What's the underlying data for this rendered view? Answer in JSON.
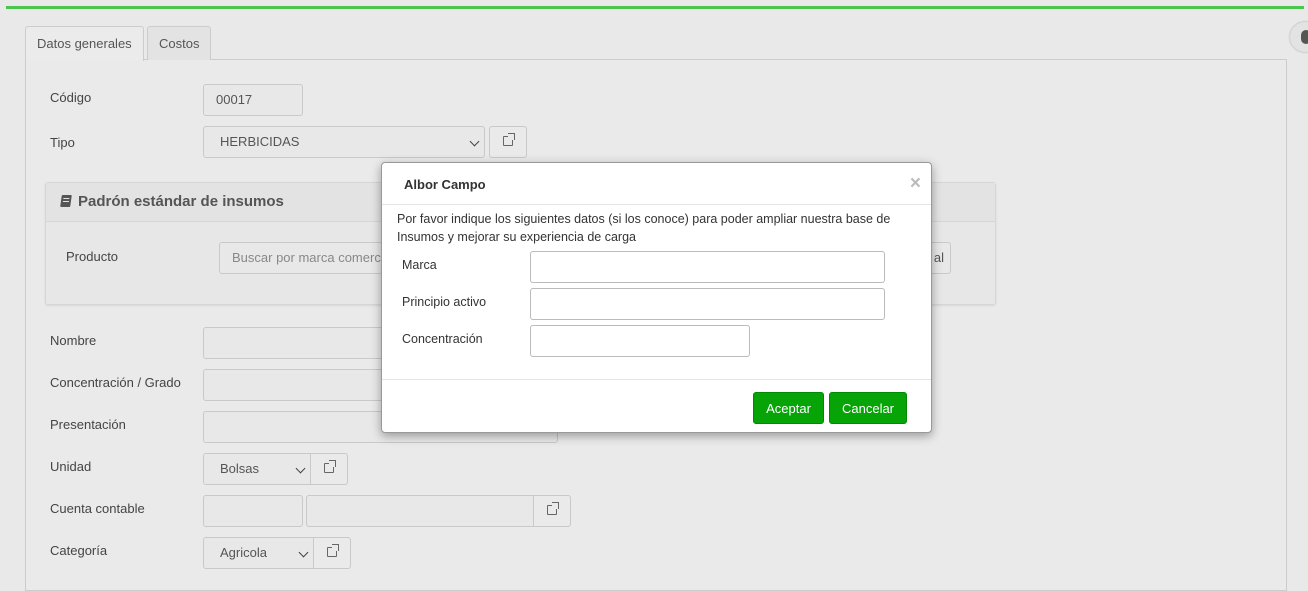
{
  "tabs": [
    {
      "label": "Datos generales",
      "active": true
    },
    {
      "label": "Costos",
      "active": false
    }
  ],
  "form": {
    "codigo_label": "Código",
    "codigo_value": "00017",
    "tipo_label": "Tipo",
    "tipo_value": "HERBICIDAS",
    "nombre_label": "Nombre",
    "concentracion_label": "Concentración / Grado",
    "presentacion_label": "Presentación",
    "unidad_label": "Unidad",
    "unidad_value": "Bolsas",
    "cuenta_label": "Cuenta contable",
    "categoria_label": "Categoría",
    "categoria_value": "Agricola"
  },
  "standard_box": {
    "title": "Padrón estándar de insumos",
    "producto_label": "Producto",
    "producto_placeholder": "Buscar por marca comercial",
    "side_button_fragment": "al"
  },
  "modal": {
    "title": "Albor Campo",
    "close_glyph": "×",
    "message": "Por favor indique los siguientes datos (si los conoce) para poder ampliar nuestra base de Insumos y mejorar su experiencia de carga",
    "marca_label": "Marca",
    "marca_value": "",
    "principio_label": "Principio activo",
    "principio_value": "",
    "concentracion_label": "Concentración",
    "concentracion_value": "",
    "accept_label": "Aceptar",
    "cancel_label": "Cancelar"
  },
  "colors": {
    "accent_green": "#06a406",
    "top_bar": "#4cc54c"
  }
}
